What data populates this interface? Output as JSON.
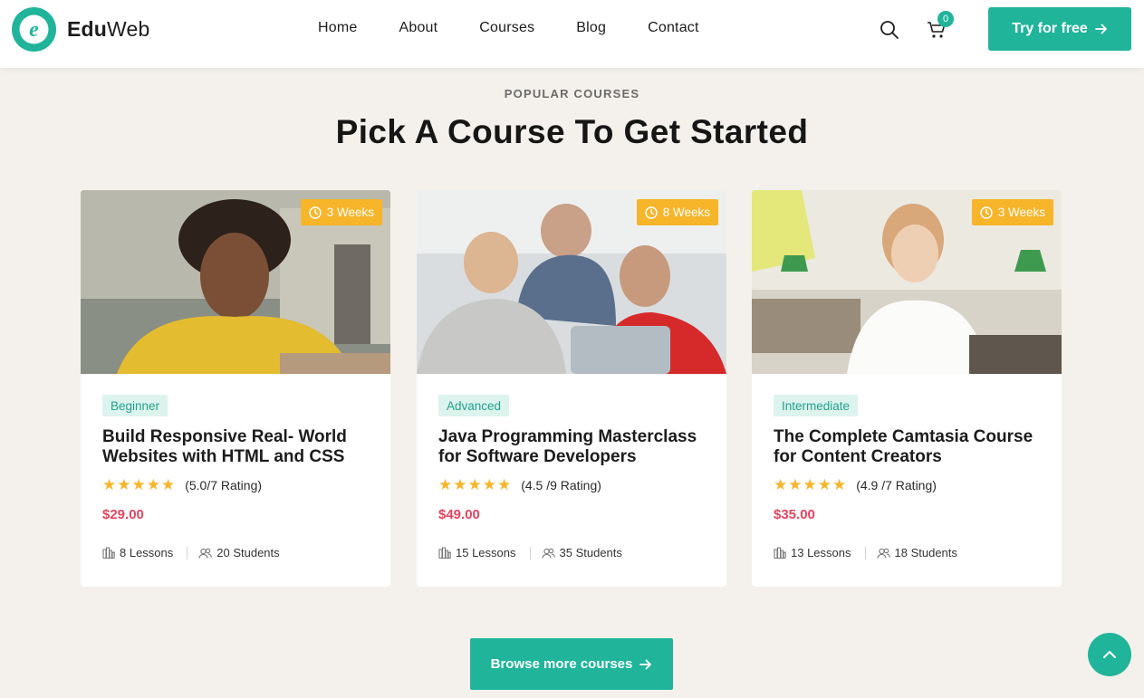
{
  "brand": {
    "name_bold": "Edu",
    "name_regular": "Web",
    "accent": "#20b49b"
  },
  "nav": [
    "Home",
    "About",
    "Courses",
    "Blog",
    "Contact"
  ],
  "header": {
    "search_icon": "search-icon",
    "cart_icon": "cart-icon",
    "cart_count": "0",
    "cta_label": "Try for free"
  },
  "section": {
    "eyebrow": "POPULAR COURSES",
    "title": "Pick A Course To Get Started"
  },
  "courses": [
    {
      "duration": "3 Weeks",
      "level": "Beginner",
      "title": "Build Responsive Real- World Websites with HTML and CSS",
      "stars": "★★★★★",
      "rating": "(5.0/7 Rating)",
      "price": "$29.00",
      "lessons": "8 Lessons",
      "students": "20 Students"
    },
    {
      "duration": "8 Weeks",
      "level": "Advanced",
      "title": "Java Programming Masterclass for Software Developers",
      "stars": "★★★★★",
      "rating": "(4.5 /9 Rating)",
      "price": "$49.00",
      "lessons": "15 Lessons",
      "students": "35 Students"
    },
    {
      "duration": "3 Weeks",
      "level": "Intermediate",
      "title": "The Complete Camtasia Course for Content Creators",
      "stars": "★★★★★",
      "rating": "(4.9 /7 Rating)",
      "price": "$35.00",
      "lessons": "13 Lessons",
      "students": "18 Students"
    }
  ],
  "browse_label": "Browse more courses",
  "colors": {
    "accent": "#20b49b",
    "badge": "#f7b52a",
    "price": "#e5445f",
    "background": "#f4f1ec"
  }
}
